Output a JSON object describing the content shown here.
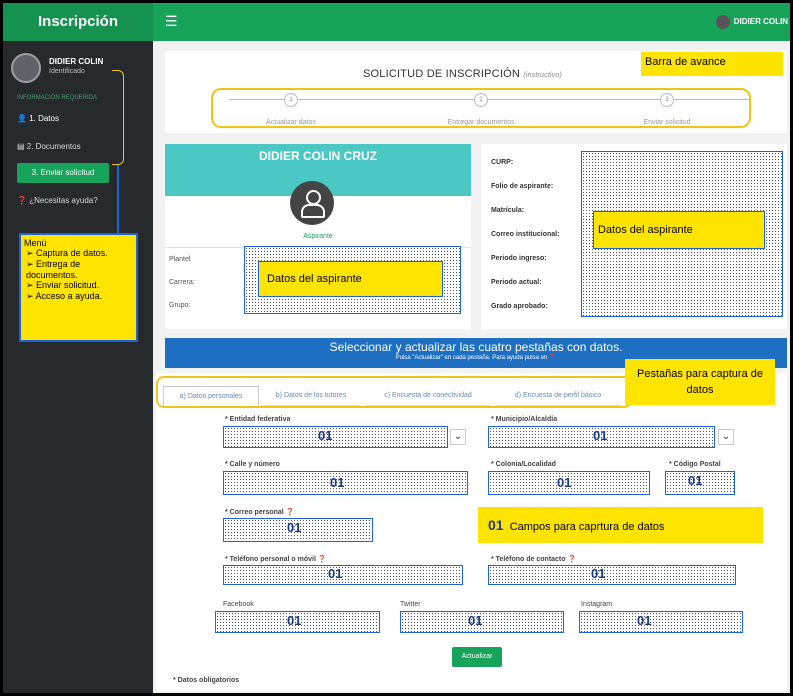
{
  "app": {
    "title": "Inscripción",
    "user_name_top": "DIDIER COLIN"
  },
  "sidebar": {
    "user_name": "DIDIER COLIN",
    "user_status": "Identificado",
    "section_title": "INFORMACIÓN REQUERIDA",
    "items": [
      {
        "label": "1. Datos"
      },
      {
        "label": "2. Documentos"
      },
      {
        "label": "3. Enviar solicitud"
      },
      {
        "label": "¿Necesitas ayuda?"
      }
    ]
  },
  "menu_note": {
    "title": "Menú",
    "items": [
      "Captura de datos.",
      "Entrega de documentos.",
      "Enviar solicitud.",
      "Acceso a ayuda."
    ]
  },
  "request": {
    "title": "SOLICITUD DE INSCRIPCIÓN",
    "instructivo": "(instructivo)",
    "progress_callout": "Barra de avance",
    "steps": [
      {
        "num": "1",
        "label": "Actualizar datos"
      },
      {
        "num": "2",
        "label": "Entregar documentos"
      },
      {
        "num": "3",
        "label": "Enviar solicitud"
      }
    ]
  },
  "profile": {
    "name": "DIDIER COLIN CRUZ",
    "role": "Aspirante",
    "left_fields": [
      "Plantel",
      "Carrera:",
      "Grupo:"
    ],
    "right_fields": [
      "CURP:",
      "Folio de aspirante:",
      "Matrícula:",
      "Correo institucional:",
      "Periodo ingreso:",
      "Periodo actual:",
      "Grado aprobado:"
    ],
    "callout": "Datos del aspirante"
  },
  "banner": {
    "title": "Seleccionar y actualizar las cuatro pestañas con datos.",
    "subtitle": "Pulsa \"Actualizar\" en cada pestaña. Para ayuda pulsa en ❓"
  },
  "tabs": {
    "items": [
      "a) Datos personales",
      "b) Datos de los tutores",
      "c) Encuesta de conectividad",
      "d) Encuesta de perfil básico"
    ],
    "callout": "Pestañas para captura de datos"
  },
  "form": {
    "code": "01",
    "legend": "Campos para caprtura de datos",
    "fields": {
      "entidad": "* Entidad federativa",
      "municipio": "* Municipio/Alcaldía",
      "calle": "* Calle y número",
      "colonia": "* Colonia/Localidad",
      "cp": "* Código Postal",
      "correo": "* Correo personal ❓",
      "tel_personal": "* Teléfono personal o móvil ❓",
      "tel_contacto": "* Teléfono de contacto ❓",
      "facebook": "Facebook",
      "twitter": "Twitter",
      "instagram": "Instagram"
    },
    "update_button": "Actualizar",
    "mandatory_note": "* Datos obligatorios"
  }
}
